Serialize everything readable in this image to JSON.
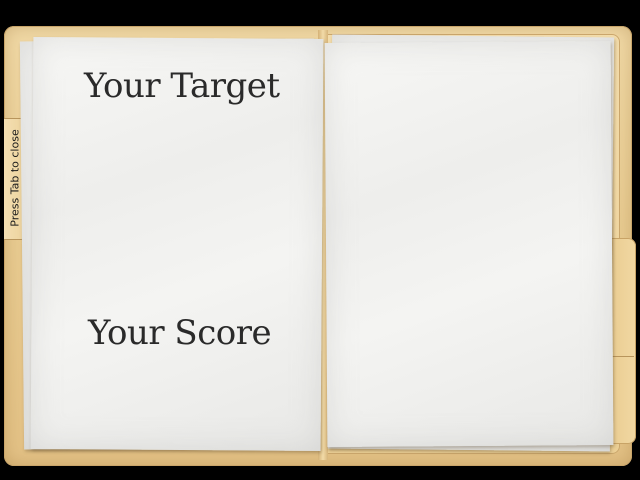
{
  "folder": {
    "close_hint": "Press Tab to close"
  },
  "left_page": {
    "target_heading": "Your Target",
    "score_heading": "Your Score"
  },
  "colors": {
    "background": "#000000",
    "folder": "#e9cc92",
    "paper": "#f4f4f2",
    "text": "#2a2a2a"
  }
}
